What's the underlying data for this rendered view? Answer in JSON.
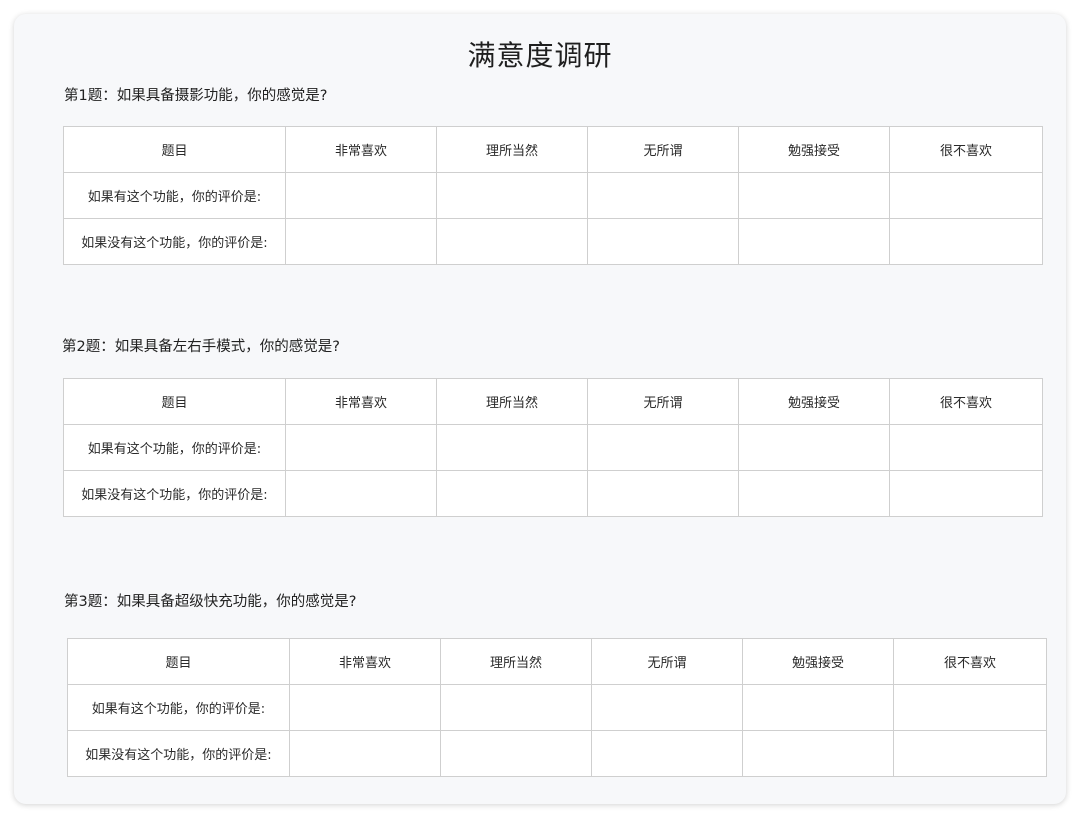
{
  "page": {
    "title": "满意度调研"
  },
  "columns": [
    "题目",
    "非常喜欢",
    "理所当然",
    "无所谓",
    "勉强接受",
    "很不喜欢"
  ],
  "rows": [
    "如果有这个功能，你的评价是:",
    "如果没有这个功能，你的评价是:"
  ],
  "questions": [
    {
      "title": "第1题：如果具备摄影功能，你的感觉是?"
    },
    {
      "title": "第2题：如果具备左右手模式，你的感觉是?"
    },
    {
      "title": "第3题：如果具备超级快充功能，你的感觉是?"
    }
  ]
}
